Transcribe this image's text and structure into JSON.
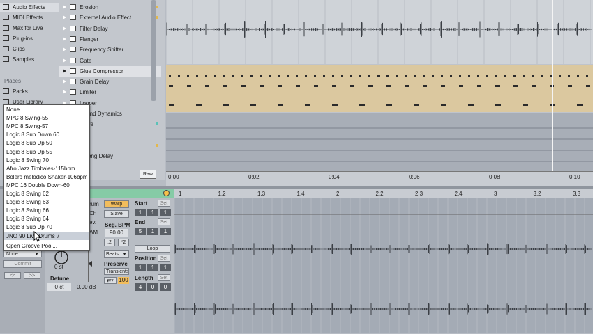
{
  "browser": {
    "categories": [
      {
        "label": "Audio Effects",
        "icon": "audio-effects-icon"
      },
      {
        "label": "MIDI Effects",
        "icon": "midi-effects-icon"
      },
      {
        "label": "Max for Live",
        "icon": "max-for-live-icon"
      },
      {
        "label": "Plug-ins",
        "icon": "plugins-icon"
      },
      {
        "label": "Clips",
        "icon": "clips-icon"
      },
      {
        "label": "Samples",
        "icon": "samples-icon"
      }
    ],
    "places_label": "Places",
    "places": [
      {
        "label": "Packs",
        "icon": "packs-icon"
      },
      {
        "label": "User Library",
        "icon": "user-library-icon"
      }
    ],
    "items": [
      {
        "label": "Erosion",
        "dot": "#e3b84b"
      },
      {
        "label": "External Audio Effect",
        "dot": "#e3b84b"
      },
      {
        "label": "Filter Delay",
        "dot": ""
      },
      {
        "label": "Flanger",
        "dot": ""
      },
      {
        "label": "Frequency Shifter",
        "dot": ""
      },
      {
        "label": "Gate",
        "dot": ""
      },
      {
        "label": "Glue Compressor",
        "dot": ""
      },
      {
        "label": "Grain Delay",
        "dot": ""
      },
      {
        "label": "Limiter",
        "dot": ""
      },
      {
        "label": "Looper",
        "dot": ""
      },
      {
        "label": "ltiband Dynamics",
        "dot": ""
      },
      {
        "label": "rdrive",
        "dot": "#5bc2b8"
      },
      {
        "label": "al",
        "dot": ""
      },
      {
        "label": "ser",
        "dot": "#e3b84b"
      },
      {
        "label": "g Pong Delay",
        "dot": ""
      }
    ],
    "raw_button": "Raw"
  },
  "groove_menu": {
    "items": [
      "None",
      "MPC 8 Swing-55",
      "MPC 8 Swing-57",
      "Logic 8 Sub Down 60",
      "Logic 8 Sub Up 50",
      "Logic 8 Sub Up 55",
      "Logic 8 Swing 70",
      "Afro Jazz Timbales-115bpm",
      "Bolero melodico Shaker-106bpm",
      "MPC 16 Double Down-60",
      "Logic 8 Swing 62",
      "Logic 8 Swing 63",
      "Logic 8 Swing 66",
      "Logic 8 Swing 64",
      "Logic 8 Sub Up 70",
      "JNO 90 Live Drums 7"
    ],
    "open_pool": "Open Groove Pool..."
  },
  "time_ruler": [
    "0:00",
    "0:02",
    "0:04",
    "0:06",
    "0:08",
    "0:10"
  ],
  "beat_ruler": [
    "1",
    "1.2",
    "1.3",
    "1.4",
    "2",
    "2.2",
    "2.3",
    "2.4",
    "3",
    "3.2",
    "3.3"
  ],
  "clip": {
    "groove_select": "None",
    "commit": "Commit",
    "nav_prev": "<<",
    "nav_next": ">>",
    "name_partial": "rum",
    "ch_partial": "Ch",
    "rev_partial": "ev.",
    "ram_partial": "AM",
    "transpose": "0 st",
    "detune_label": "Detune",
    "detune": "0 ct",
    "gain": "0.00 dB",
    "warp": "Warp",
    "slave": "Slave",
    "seg_bpm_label": "Seg. BPM",
    "seg_bpm": "90.00",
    "half": ":2",
    "double": "*2",
    "warp_mode": "Beats",
    "preserve_label": "Preserve",
    "preserve": "Transients",
    "loop_amount": "100",
    "start_label": "Start",
    "start": [
      "1",
      "1",
      "1"
    ],
    "end_label": "End",
    "end": [
      "5",
      "1",
      "1"
    ],
    "loop": "Loop",
    "position_label": "Position",
    "position": [
      "1",
      "1",
      "1"
    ],
    "length_label": "Length",
    "length": [
      "4",
      "0",
      "0"
    ],
    "set": "Set"
  }
}
